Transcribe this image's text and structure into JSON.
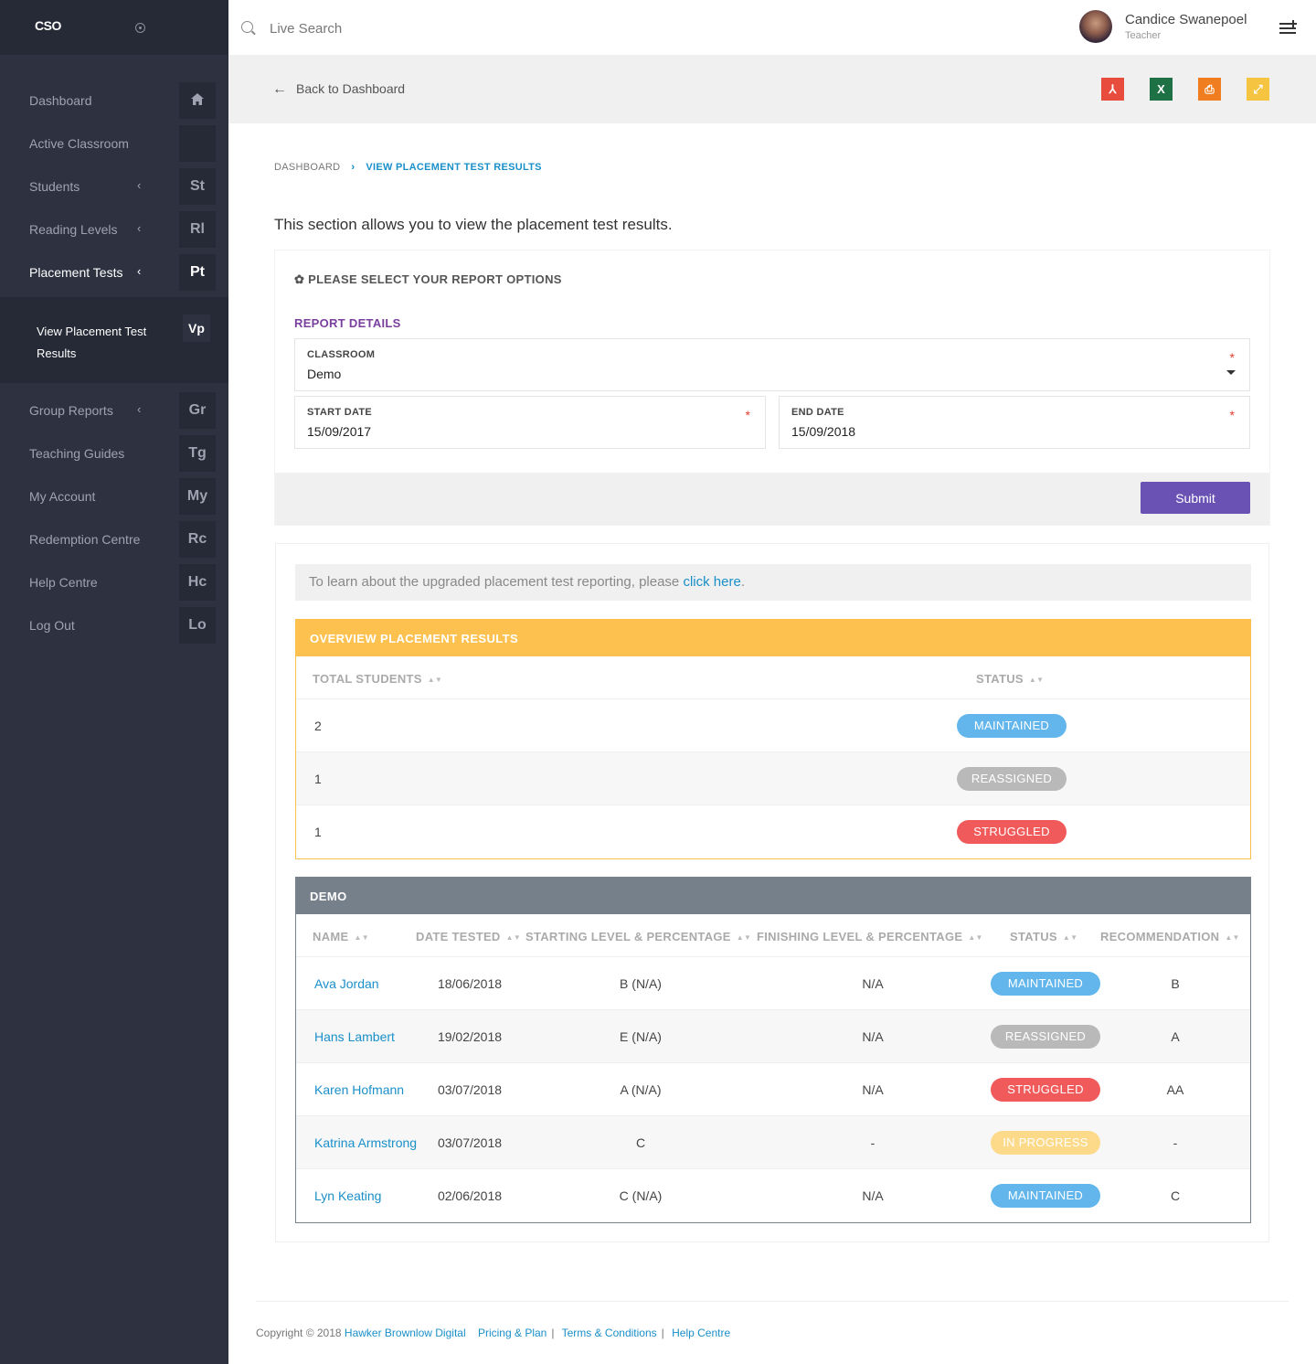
{
  "app": {
    "logo": "CSO",
    "colors": {
      "accent_purple": "#6a52b5",
      "link_blue": "#1a8fc9",
      "overview_gold": "#fdc150",
      "demo_gray": "#76808b"
    }
  },
  "sidebar": {
    "items": [
      {
        "label": "Dashboard",
        "box": "",
        "icon": "home-icon",
        "chevron": ""
      },
      {
        "label": "Active Classroom",
        "box": "",
        "chevron": ""
      },
      {
        "label": "Students",
        "box": "St",
        "chevron": "‹"
      },
      {
        "label": "Reading Levels",
        "box": "Rl",
        "chevron": "‹"
      },
      {
        "label": "Placement Tests",
        "box": "Pt",
        "chevron": "‹"
      },
      {
        "label": "Group Reports",
        "box": "Gr",
        "chevron": "‹"
      },
      {
        "label": "Teaching Guides",
        "box": "Tg",
        "chevron": ""
      },
      {
        "label": "My Account",
        "box": "My",
        "chevron": ""
      },
      {
        "label": "Redemption Centre",
        "box": "Rc",
        "chevron": ""
      },
      {
        "label": "Help Centre",
        "box": "Hc",
        "chevron": ""
      },
      {
        "label": "Log Out",
        "box": "Lo",
        "chevron": ""
      }
    ],
    "submenu": {
      "label": "View Placement Test Results",
      "box": "Vp"
    }
  },
  "topbar": {
    "search_placeholder": "Live Search",
    "user_name": "Candice Swanepoel",
    "user_role": "Teacher"
  },
  "actionbar": {
    "back_label": "Back to Dashboard",
    "back_arrow": "←",
    "export_icons": [
      {
        "name": "pdf-export-icon",
        "glyph": "⅄",
        "color": "#e84c3d"
      },
      {
        "name": "excel-export-icon",
        "glyph": "X",
        "color": "#1e7145"
      },
      {
        "name": "print-icon",
        "glyph": "⎙",
        "color": "#f07d1f"
      },
      {
        "name": "share-icon",
        "glyph": "⤢",
        "color": "#f5c542"
      }
    ]
  },
  "breadcrumb": {
    "home": "DASHBOARD",
    "sep": "›",
    "current": "VIEW PLACEMENT TEST RESULTS"
  },
  "intro": "This section allows you to view the placement test results.",
  "options": {
    "title": "✿ PLEASE SELECT YOUR REPORT OPTIONS",
    "section": "REPORT DETAILS",
    "classroom": {
      "label": "CLASSROOM",
      "value": "Demo"
    },
    "start_date": {
      "label": "START DATE",
      "value": "15/09/2017"
    },
    "end_date": {
      "label": "END DATE",
      "value": "15/09/2018"
    },
    "required_mark": "*",
    "submit_label": "Submit"
  },
  "info": {
    "text": "To learn about the upgraded placement test reporting, please ",
    "link": "click here",
    "tail": "."
  },
  "overview": {
    "title": "OVERVIEW PLACEMENT RESULTS",
    "headers": {
      "total": "TOTAL STUDENTS",
      "status": "STATUS"
    },
    "rows": [
      {
        "total": "2",
        "status": "MAINTAINED",
        "color": "#63b6ec"
      },
      {
        "total": "1",
        "status": "REASSIGNED",
        "color": "#b9b9b9"
      },
      {
        "total": "1",
        "status": "STRUGGLED",
        "color": "#f05a5a"
      }
    ]
  },
  "demo": {
    "title": "DEMO",
    "headers": {
      "name": "NAME",
      "date": "DATE TESTED",
      "start": "STARTING LEVEL & PERCENTAGE",
      "finish": "FINISHING LEVEL & PERCENTAGE",
      "status": "STATUS",
      "rec": "RECOMMENDATION"
    },
    "rows": [
      {
        "name": "Ava Jordan",
        "date": "18/06/2018",
        "start": "B (N/A)",
        "finish": "N/A",
        "status": "MAINTAINED",
        "color": "#63b6ec",
        "rec": "B"
      },
      {
        "name": "Hans Lambert",
        "date": "19/02/2018",
        "start": "E (N/A)",
        "finish": "N/A",
        "status": "REASSIGNED",
        "color": "#b9b9b9",
        "rec": "A"
      },
      {
        "name": "Karen Hofmann",
        "date": "03/07/2018",
        "start": "A (N/A)",
        "finish": "N/A",
        "status": "STRUGGLED",
        "color": "#f05a5a",
        "rec": "AA"
      },
      {
        "name": "Katrina Armstrong",
        "date": "03/07/2018",
        "start": "C",
        "finish": "-",
        "status": "IN PROGRESS",
        "color": "#fdd98a",
        "rec": "-"
      },
      {
        "name": "Lyn Keating",
        "date": "02/06/2018",
        "start": "C (N/A)",
        "finish": "N/A",
        "status": "MAINTAINED",
        "color": "#63b6ec",
        "rec": "C"
      }
    ]
  },
  "footer": {
    "copyright": "Copyright © 2018",
    "company": "Hawker Brownlow Digital",
    "links": [
      "Pricing & Plan",
      "Terms & Conditions",
      "Help Centre"
    ],
    "pipe": "|"
  }
}
